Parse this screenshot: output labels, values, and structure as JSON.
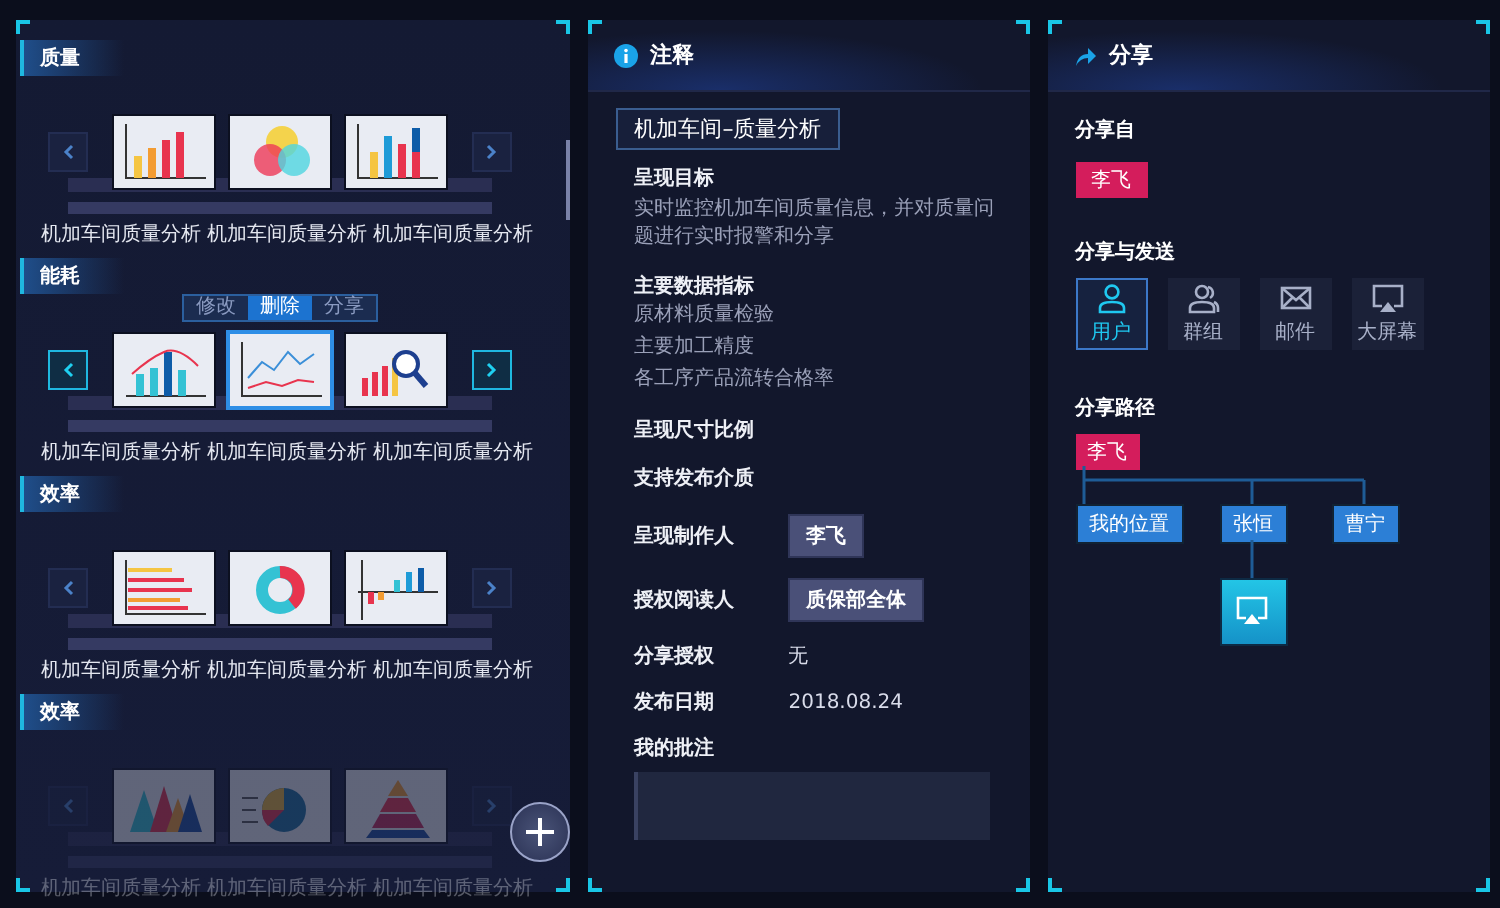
{
  "gallery": {
    "sections": [
      {
        "label": "质量",
        "focused": false,
        "disabled": false,
        "thumbs": [
          {
            "kind": "bar",
            "caption": "机加车间质量分析",
            "selected": false
          },
          {
            "kind": "venn",
            "caption": "机加车间质量分析",
            "selected": false
          },
          {
            "kind": "stacked",
            "caption": "机加车间质量分析",
            "selected": false
          }
        ]
      },
      {
        "label": "能耗",
        "focused": true,
        "disabled": false,
        "thumbs": [
          {
            "kind": "combo",
            "caption": "机加车间质量分析",
            "selected": false
          },
          {
            "kind": "line",
            "caption": "机加车间质量分析",
            "selected": true,
            "menu": {
              "items": [
                {
                  "label": "修改",
                  "selected": false
                },
                {
                  "label": "删除",
                  "selected": true
                },
                {
                  "label": "分享",
                  "selected": false
                }
              ]
            }
          },
          {
            "kind": "magnify",
            "caption": "机加车间质量分析",
            "selected": false
          }
        ]
      },
      {
        "label": "效率",
        "focused": false,
        "disabled": false,
        "thumbs": [
          {
            "kind": "hbar",
            "caption": "机加车间质量分析",
            "selected": false
          },
          {
            "kind": "donut",
            "caption": "机加车间质量分析",
            "selected": false
          },
          {
            "kind": "posneg",
            "caption": "机加车间质量分析",
            "selected": false
          }
        ]
      },
      {
        "label": "效率",
        "focused": false,
        "disabled": true,
        "thumbs": [
          {
            "kind": "peaks",
            "caption": "机加车间质量分析",
            "selected": false
          },
          {
            "kind": "pie",
            "caption": "机加车间质量分析",
            "selected": false
          },
          {
            "kind": "pyramid",
            "caption": "机加车间质量分析",
            "selected": false
          }
        ]
      }
    ]
  },
  "notes": {
    "title": "注释",
    "heading": "机加车间–质量分析",
    "fields": [
      {
        "kind": "text",
        "label": "呈现目标",
        "text": "实时监控机加车间质量信息，并对质量问题进行实时报警和分享"
      },
      {
        "kind": "list",
        "label": "主要数据指标",
        "items": [
          "原材料质量检验",
          "主要加工精度",
          "各工序产品流转合格率"
        ]
      },
      {
        "kind": "plain",
        "label": "呈现尺寸比例"
      },
      {
        "kind": "plain",
        "label": "支持发布介质"
      },
      {
        "kind": "tag",
        "label": "呈现制作人",
        "value": "李飞"
      },
      {
        "kind": "tag",
        "label": "授权阅读人",
        "value": "质保部全体"
      },
      {
        "kind": "value",
        "label": "分享授权",
        "value": "无"
      },
      {
        "kind": "value",
        "label": "发布日期",
        "value": "2018.08.24"
      },
      {
        "kind": "comment",
        "label": "我的批注"
      }
    ]
  },
  "share": {
    "title": "分享",
    "from_label": "分享自",
    "from": "李飞",
    "send_label": "分享与发送",
    "options": [
      {
        "kind": "user",
        "label": "用户",
        "selected": true
      },
      {
        "kind": "group",
        "label": "群组",
        "selected": false
      },
      {
        "kind": "mail",
        "label": "邮件",
        "selected": false
      },
      {
        "kind": "screen",
        "label": "大屏幕",
        "selected": false
      }
    ],
    "path_label": "分享路径",
    "path": {
      "label": "李飞",
      "children": [
        {
          "label": "我的位置"
        },
        {
          "label": "张恒",
          "children": [
            {
              "kind": "screen"
            }
          ]
        },
        {
          "label": "曹宁"
        }
      ]
    }
  }
}
